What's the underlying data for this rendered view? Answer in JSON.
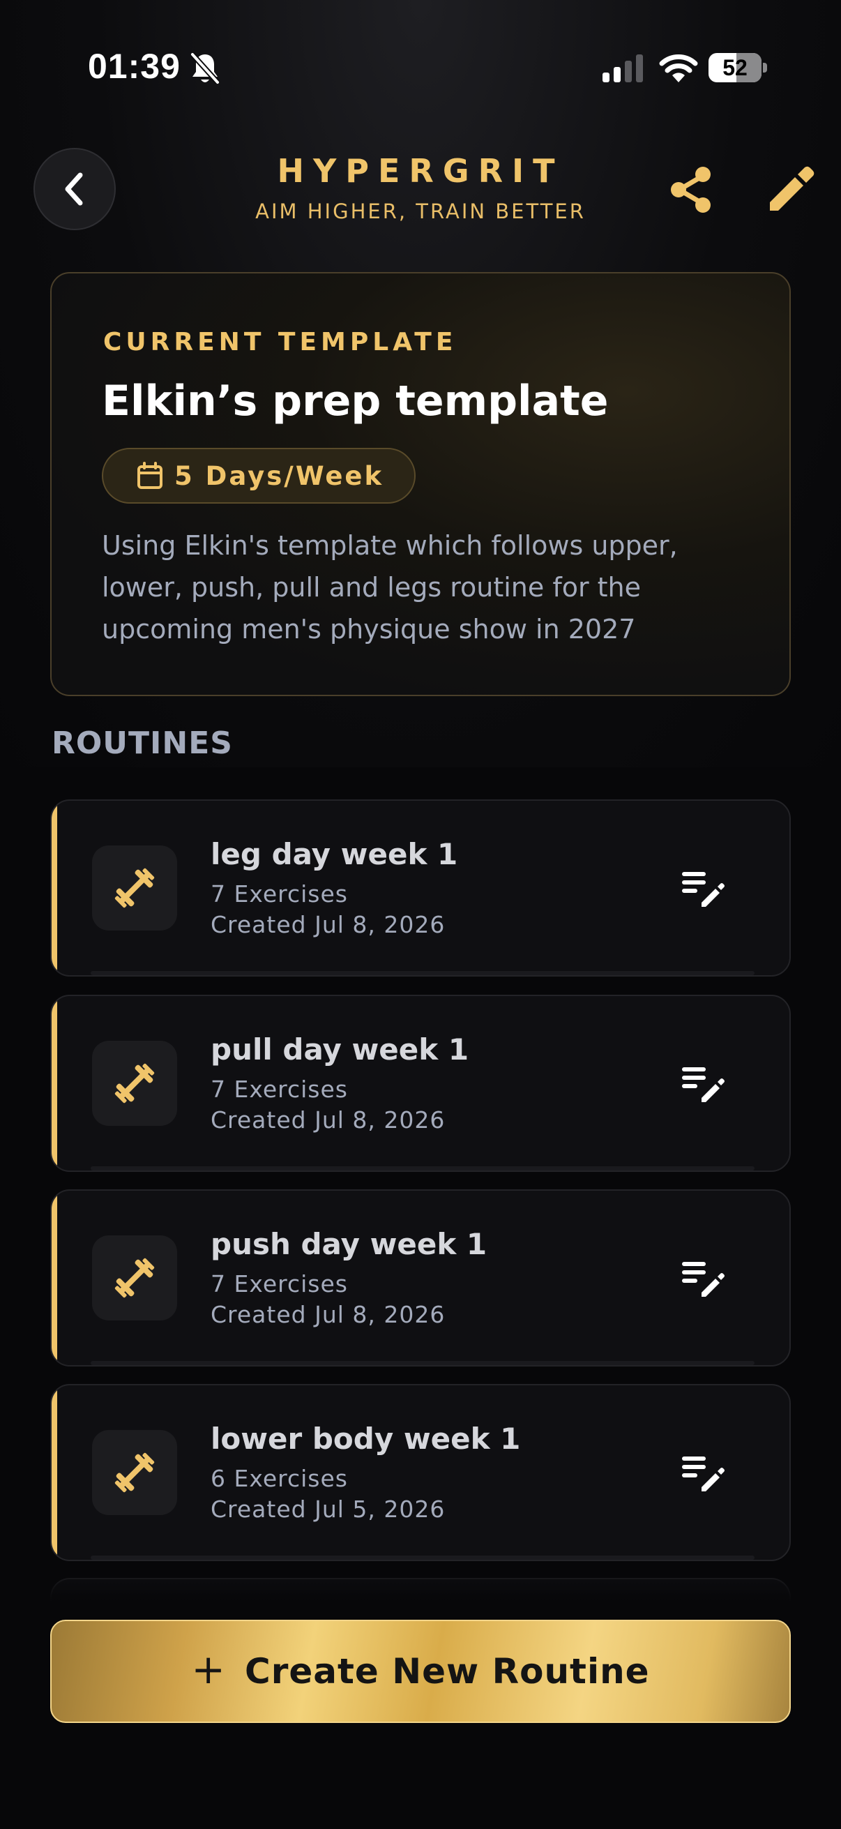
{
  "status_bar": {
    "time": "01:39",
    "battery_level": "52",
    "icons": [
      "bell-slash-icon",
      "cellular-signal-icon",
      "wifi-icon",
      "battery-icon"
    ]
  },
  "header": {
    "brand_title": "HYPERGRIT",
    "brand_subtitle": "AIM HIGHER, TRAIN BETTER",
    "icons": [
      "chevron-left-icon",
      "share-icon",
      "pencil-icon"
    ]
  },
  "template": {
    "label": "CURRENT TEMPLATE",
    "title": "Elkin’s prep template",
    "frequency": "5 Days/Week",
    "description": "Using Elkin's template which follows upper, lower, push, pull and legs routine for the upcoming men's physique show in 2027"
  },
  "routines_label": "ROUTINES",
  "routines": [
    {
      "name": "leg day week 1",
      "exercises": "7 Exercises",
      "created": "Created Jul 8, 2026"
    },
    {
      "name": "pull day week 1",
      "exercises": "7 Exercises",
      "created": "Created Jul 8, 2026"
    },
    {
      "name": "push day week 1",
      "exercises": "7 Exercises",
      "created": "Created Jul 8, 2026"
    },
    {
      "name": "lower body week 1",
      "exercises": "6 Exercises",
      "created": "Created Jul 5, 2026"
    }
  ],
  "create_button": {
    "plus": "+",
    "label": "Create New Routine"
  },
  "colors": {
    "accent_gold": "#f0c46a",
    "background": "#070709",
    "card": "#0f0f12",
    "muted_text": "#a4abbc"
  }
}
